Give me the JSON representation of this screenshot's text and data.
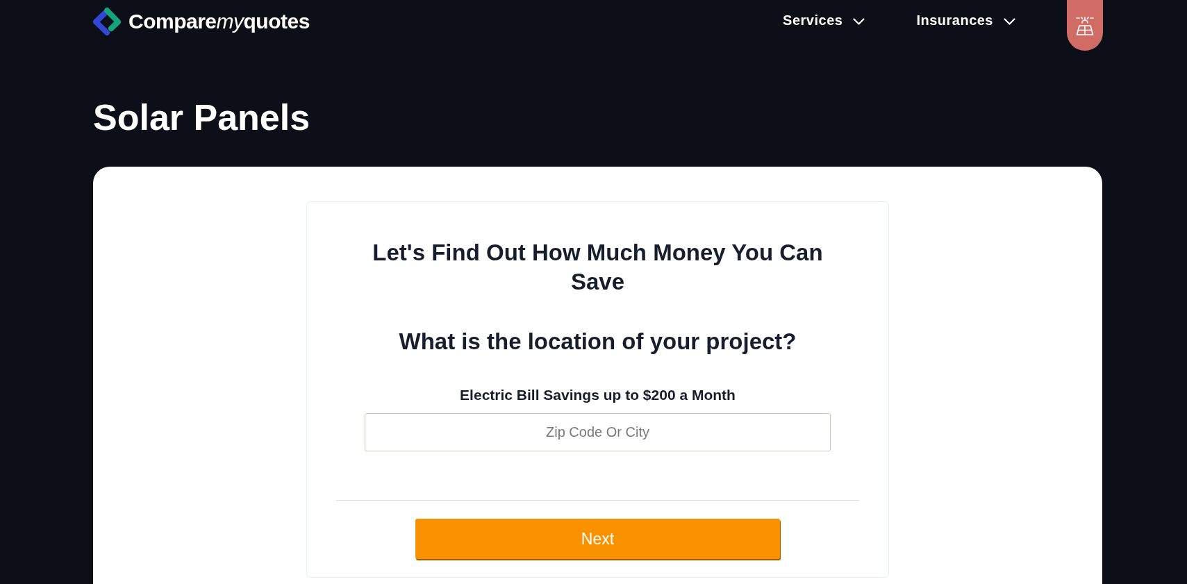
{
  "header": {
    "logo": {
      "parts": [
        {
          "text": "Compare",
          "italic": false
        },
        {
          "text": "my",
          "italic": true
        },
        {
          "text": "quotes",
          "italic": false
        }
      ]
    },
    "nav": [
      {
        "label": "Services"
      },
      {
        "label": "Insurances"
      }
    ]
  },
  "page": {
    "title": "Solar Panels"
  },
  "form": {
    "heading": "Let's Find Out How Much Money You Can Save",
    "question": "What is the location of your project?",
    "field": {
      "label": "Electric Bill Savings up to $200 a Month",
      "placeholder": "Zip Code Or City"
    },
    "button": "Next"
  }
}
